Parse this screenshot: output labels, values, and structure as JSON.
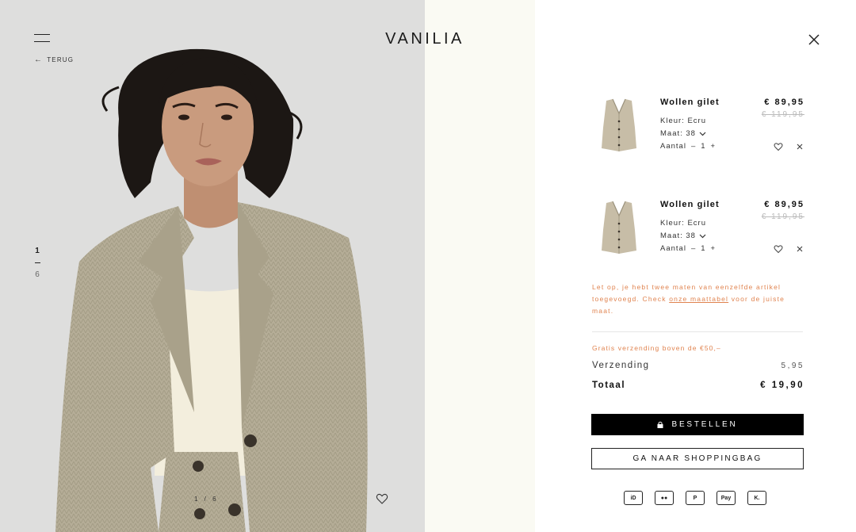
{
  "brand": {
    "logo": "VANILIA"
  },
  "nav": {
    "menu_icon": "hamburger-icon",
    "back_label": "TERUG",
    "back_icon": "arrow-left-icon"
  },
  "gallery": {
    "slide_current": "1",
    "slide_total": "6",
    "image_pager": "1 / 6",
    "favorite_icon": "heart-icon"
  },
  "cart": {
    "close_icon": "close-icon",
    "items": [
      {
        "name": "Wollen gilet",
        "price": "€ 89,95",
        "old_price": "€ 119,95",
        "color_label": "Kleur: Ecru",
        "size_label": "Maat: 38",
        "qty_label": "Aantal",
        "qty_minus": "–",
        "qty_value": "1",
        "qty_plus": "+"
      },
      {
        "name": "Wollen gilet",
        "price": "€ 89,95",
        "old_price": "€ 119,95",
        "color_label": "Kleur: Ecru",
        "size_label": "Maat: 38",
        "qty_label": "Aantal",
        "qty_minus": "–",
        "qty_value": "1",
        "qty_plus": "+"
      }
    ],
    "warning": {
      "text_before": "Let op, je hebt twee maten van eenzelfde artikel toegevoegd. Check ",
      "link": "onze maattabel",
      "text_after": " voor de juiste maat."
    },
    "free_shipping": "Gratis verzending boven de €50,–",
    "shipping_label": "Verzending",
    "shipping_value": "5,95",
    "total_label": "Totaal",
    "total_value": "€ 19,90",
    "order_button": "BESTELLEN",
    "bag_button": "GA NAAR SHOPPINGBAG",
    "payment_methods": [
      "ideal-icon",
      "mastercard-icon",
      "paypal-icon",
      "apple-pay-icon",
      "klarna-icon"
    ],
    "payment_labels": [
      "iD",
      "●●",
      "P",
      "Pay",
      "K."
    ]
  }
}
